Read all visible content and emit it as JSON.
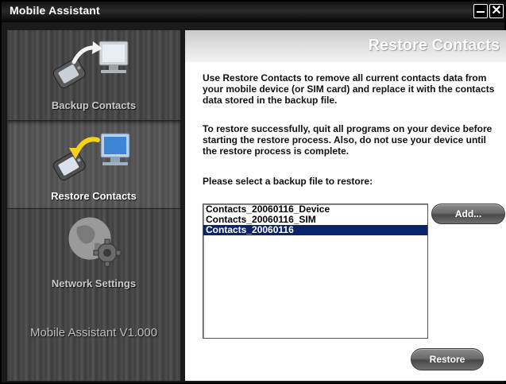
{
  "window": {
    "title": "Mobile Assistant"
  },
  "sidebar": {
    "items": [
      {
        "label": "Backup Contacts",
        "icon": "phone-backup-icon",
        "selected": false
      },
      {
        "label": "Restore Contacts",
        "icon": "phone-restore-icon",
        "selected": true
      },
      {
        "label": "Network Settings",
        "icon": "globe-gear-icon",
        "selected": false
      }
    ],
    "version": "Mobile Assistant V1.000"
  },
  "main": {
    "title": "Restore Contacts",
    "intro": "Use Restore Contacts to remove all current contacts data from your mobile device (or SIM card) and replace it with the contacts data stored in the backup file.",
    "warning": "To restore successfully, quit all programs on your device before starting the restore process. Also, do not use your device until the restore process is complete.",
    "prompt": "Please select a backup file to restore:",
    "files": [
      "Contacts_20060116_Device",
      "Contacts_20060116_SIM",
      "Contacts_20060116"
    ],
    "selected_file": "Contacts_20060116",
    "add_label": "Add...",
    "restore_label": "Restore"
  },
  "colors": {
    "selection": "#0a246a",
    "title_bar": "#000000",
    "sidebar": "#454545"
  }
}
